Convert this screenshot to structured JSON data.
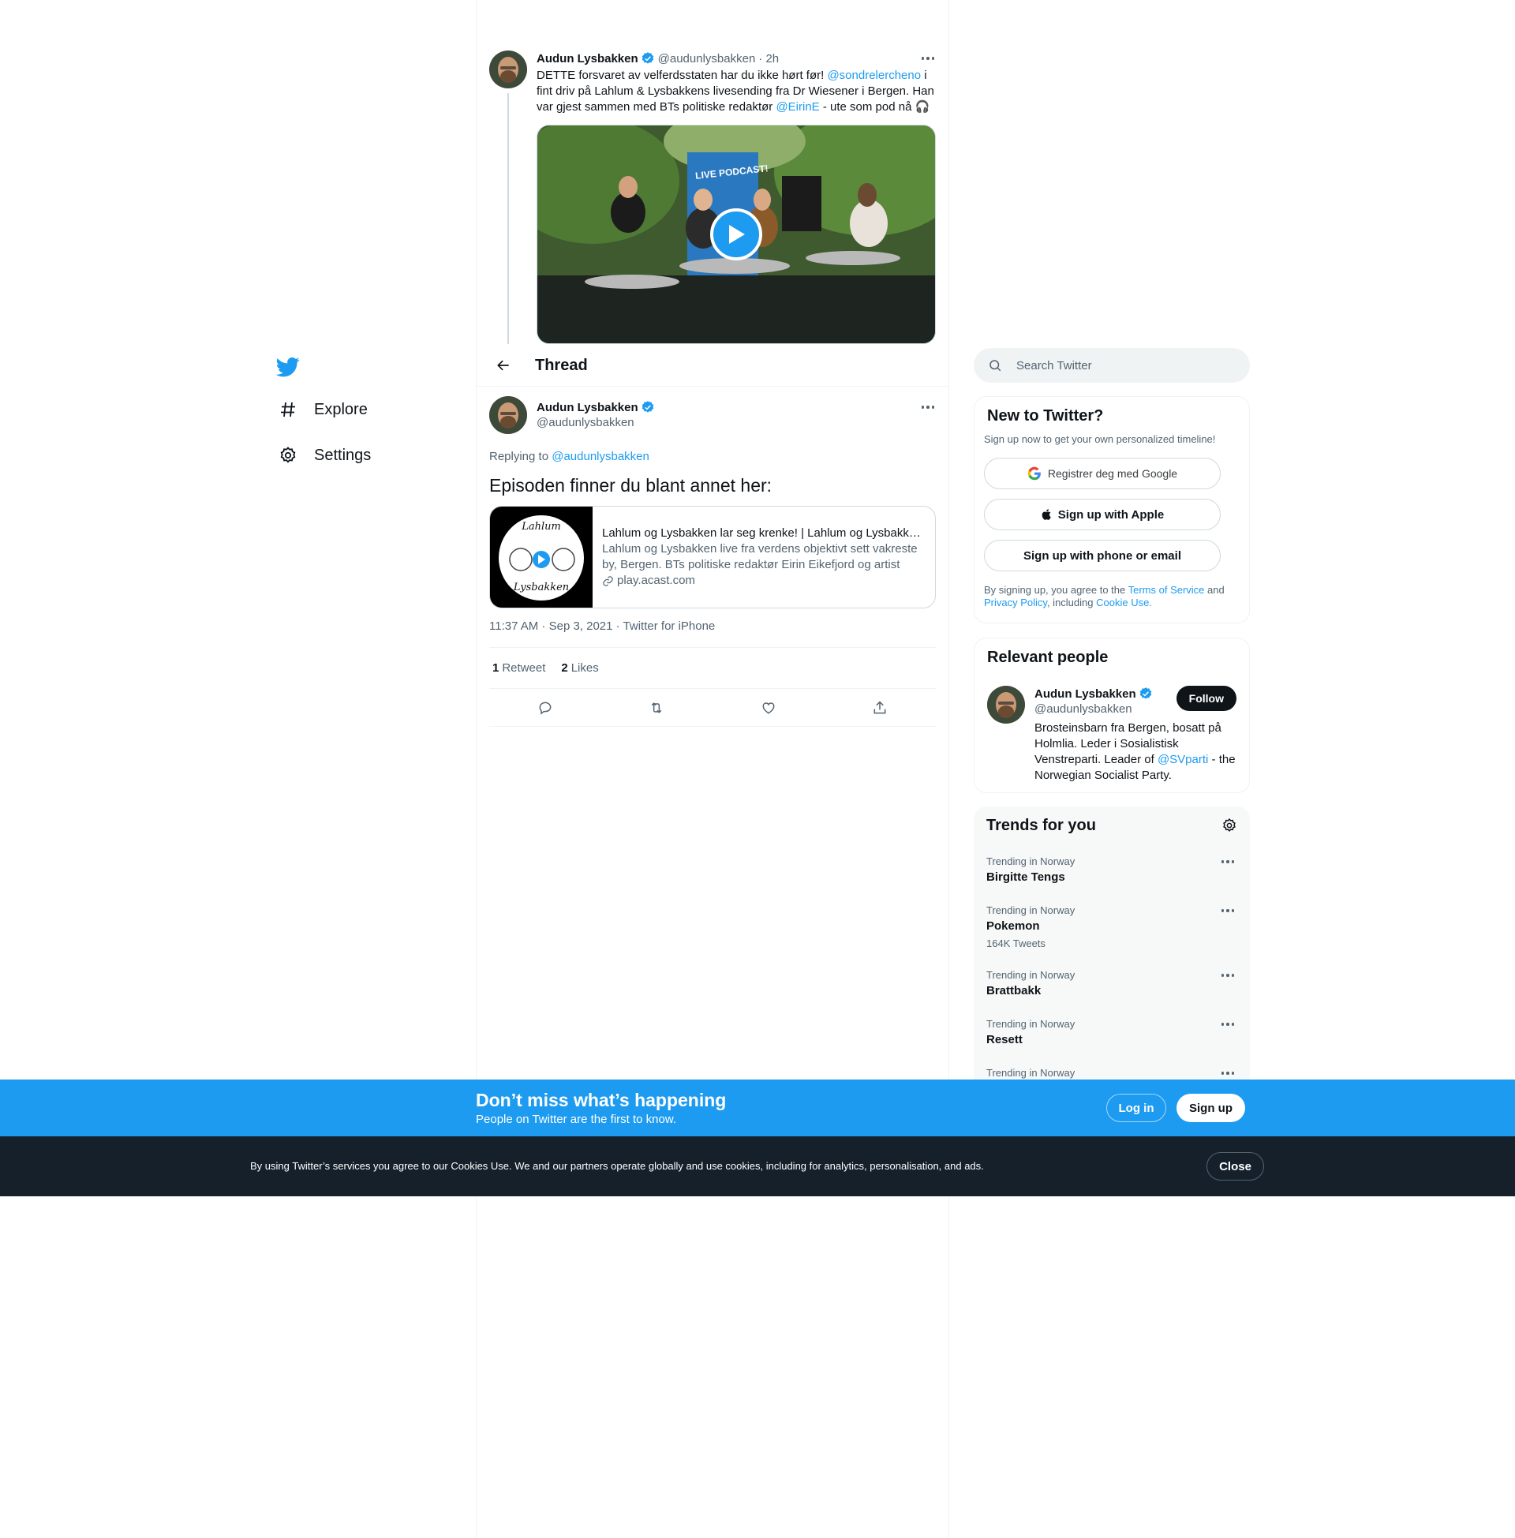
{
  "nav": {
    "items": [
      {
        "label": "Explore",
        "icon": "hashtag-icon"
      },
      {
        "label": "Settings",
        "icon": "gear-icon"
      }
    ]
  },
  "top_tweet": {
    "author": "Audun Lysbakken",
    "handle": "@audunlysbakken",
    "time": "· 2h",
    "text_1": "DETTE forsvaret av velferdsstaten har du ikke hørt før! ",
    "mention_1": "@sondrelercheno",
    "text_2": " i fint driv på Lahlum & Lysbakkens livesending fra Dr Wiesener i Bergen. Han var gjest sammen med BTs politiske redaktør ",
    "mention_2": "@EirinE",
    "text_3": " - ute som pod nå 🎧",
    "banner_text": "LIVE PODCAST!"
  },
  "header": {
    "title": "Thread"
  },
  "main_tweet": {
    "author": "Audun Lysbakken",
    "handle": "@audunlysbakken",
    "replying_label": "Replying to ",
    "replying_to": "@audunlysbakken",
    "text": "Episoden finner du blant annet her:",
    "card": {
      "title": "Lahlum og Lysbakken lar seg krenke! | Lahlum og Lysbakken | Acast",
      "description": "Lahlum og Lysbakken live fra verdens objektivt sett vakreste by, Bergen. BTs politiske redaktør Eirin Eikefjord og artist Sondre Lerche.",
      "domain": "play.acast.com",
      "logo_top": "Lahlum",
      "logo_bottom": "Lysbakken"
    },
    "meta": "11:37 AM · Sep 3, 2021 · Twitter for iPhone",
    "retweets_count": "1",
    "retweets_label": "Retweet",
    "likes_count": "2",
    "likes_label": "Likes"
  },
  "search": {
    "placeholder": "Search Twitter"
  },
  "new_to_twitter": {
    "title": "New to Twitter?",
    "subtitle": "Sign up now to get your own personalized timeline!",
    "google": "Registrer deg med Google",
    "apple": "Sign up with Apple",
    "phone": "Sign up with phone or email",
    "legal_1": "By signing up, you agree to the ",
    "terms": "Terms of Service",
    "legal_2": " and ",
    "privacy": "Privacy Policy",
    "legal_3": ", including ",
    "cookie": "Cookie Use."
  },
  "relevant": {
    "title": "Relevant people",
    "name": "Audun Lysbakken",
    "handle": "@audunlysbakken",
    "follow": "Follow",
    "bio_1": "Brosteinsbarn fra Bergen, bosatt på Holmlia. Leder i Sosialistisk Venstreparti. Leader of ",
    "bio_mention": "@SVparti",
    "bio_2": " - the Norwegian Socialist Party."
  },
  "trends": {
    "title": "Trends for you",
    "items": [
      {
        "context": "Trending in Norway",
        "name": "Birgitte Tengs",
        "count": ""
      },
      {
        "context": "Trending in Norway",
        "name": "Pokemon",
        "count": "164K Tweets"
      },
      {
        "context": "Trending in Norway",
        "name": "Brattbakk",
        "count": ""
      },
      {
        "context": "Trending in Norway",
        "name": "Resett",
        "count": ""
      },
      {
        "context": "Trending in Norway",
        "name": "",
        "count": ""
      }
    ]
  },
  "banner": {
    "title": "Don’t miss what’s happening",
    "subtitle": "People on Twitter are the first to know.",
    "login": "Log in",
    "signup": "Sign up"
  },
  "cookie_bar": {
    "text": "By using Twitter’s services you agree to our Cookies Use. We and our partners operate globally and use cookies, including for analytics, personalisation, and ads.",
    "close": "Close"
  },
  "colors": {
    "accent": "#1d9bf0",
    "text": "#0f1419",
    "muted": "#536471",
    "dark": "#15202b"
  }
}
